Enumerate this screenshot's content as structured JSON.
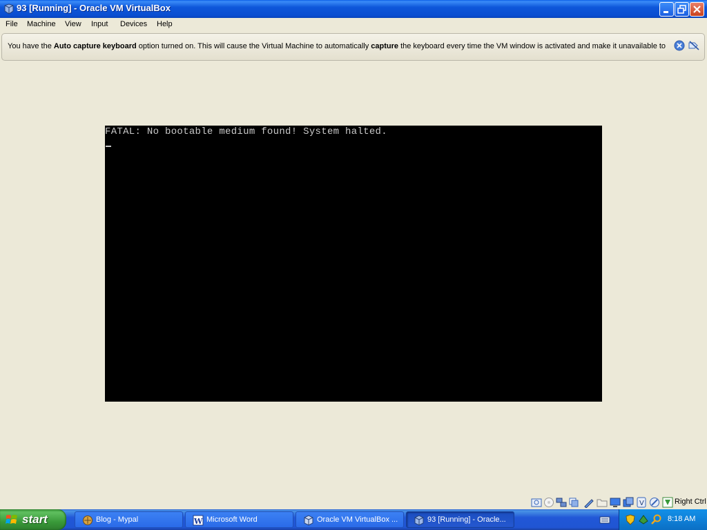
{
  "window": {
    "title": "93 [Running] - Oracle VM VirtualBox",
    "icon": "virtualbox-icon",
    "controls": [
      "minimize-icon",
      "restore-icon",
      "close-icon"
    ]
  },
  "menu": {
    "items": [
      "File",
      "Machine",
      "View",
      "Input",
      "Devices",
      "Help"
    ]
  },
  "banner": {
    "pre": "You have the ",
    "bold1": "Auto capture keyboard",
    "mid": " option turned on. This will cause the Virtual Machine to automatically ",
    "bold2": "capture",
    "post": " the keyboard every time the VM window is activated and make it unavailable to",
    "close_icon": "close-icon",
    "dont_show_icon": "dont-show-again-icon"
  },
  "vm_console": {
    "line1": "FATAL: No bootable medium found! System halted.",
    "background": "#000000",
    "text_color": "#C8C8C8"
  },
  "statusbar": {
    "indicators": [
      "hard-disk-icon",
      "optical-drive-icon",
      "network-icon",
      "usb-icon",
      "shared-folders-icon",
      "display-icon",
      "video-capture-icon",
      "virtualization-icon",
      "mouse-integration-icon",
      "keyboard-capture-icon"
    ],
    "host_key": "Right Ctrl"
  },
  "taskbar": {
    "start_label": "start",
    "tasks": [
      {
        "label": "Blog - Mypal",
        "icon": "mypal-browser-icon"
      },
      {
        "label": "Microsoft Word",
        "icon": "word-icon"
      },
      {
        "label": "Oracle VM VirtualBox ...",
        "icon": "virtualbox-icon"
      },
      {
        "label": "93 [Running] - Oracle...",
        "icon": "virtualbox-vm-icon",
        "active": true
      }
    ],
    "tray_icons": [
      "security-shield-icon",
      "network-status-icon",
      "search-icon"
    ],
    "clock": "8:18 AM",
    "colors": {
      "taskbar": "#2157D7",
      "start": "#3A9A3A",
      "tray": "#0F80D8"
    }
  }
}
